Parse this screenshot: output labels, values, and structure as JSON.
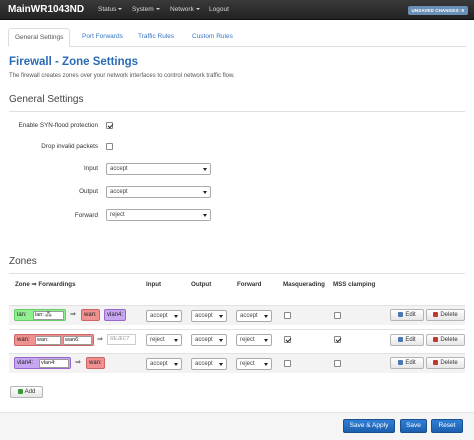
{
  "nav": {
    "brand": "MainWR1043ND",
    "items": [
      "Status",
      "System",
      "Network",
      "Logout"
    ],
    "unsaved": "UNSAVED CHANGES: 9"
  },
  "tabs": [
    "General Settings",
    "Port Forwards",
    "Traffic Rules",
    "Custom Rules"
  ],
  "page": {
    "title": "Firewall - Zone Settings",
    "description": "The firewall creates zones over your network interfaces to control network traffic flow."
  },
  "general": {
    "title": "General Settings",
    "syn_flood_label": "Enable SYN-flood protection",
    "syn_flood_checked": true,
    "drop_invalid_label": "Drop invalid packets",
    "drop_invalid_checked": false,
    "input_label": "Input",
    "input_value": "accept",
    "output_label": "Output",
    "output_value": "accept",
    "forward_label": "Forward",
    "forward_value": "reject"
  },
  "zones": {
    "title": "Zones",
    "headers": [
      "Zone ⇒ Forwardings",
      "Input",
      "Output",
      "Forward",
      "Masquerading",
      "MSS clamping"
    ],
    "rows": [
      {
        "zone": "lan:",
        "networks": [
          "lan:",
          "🖧"
        ],
        "forward_to": [
          "wan:",
          "vlan4:"
        ],
        "input": "accept",
        "output": "accept",
        "forward": "accept",
        "masquerading": false,
        "mss": false,
        "color": "#90f090"
      },
      {
        "zone": "wan:",
        "networks": [
          "wan:",
          "wan6:"
        ],
        "forward_to": [
          "REJECT"
        ],
        "input": "reject",
        "output": "accept",
        "forward": "reject",
        "masquerading": true,
        "mss": true,
        "color": "#f09090"
      },
      {
        "zone": "vlan4:",
        "networks": [
          "vlan4:"
        ],
        "forward_to": [
          "wan:"
        ],
        "input": "accept",
        "output": "accept",
        "forward": "reject",
        "masquerading": false,
        "mss": false,
        "color": "#c7a7f2"
      }
    ],
    "edit_label": "Edit",
    "delete_label": "Delete",
    "add_label": "Add"
  },
  "footer": {
    "save_apply": "Save & Apply",
    "save": "Save",
    "reset": "Reset"
  },
  "colors": {
    "accent": "#2a6bb5",
    "lan_zone": "#90f090",
    "wan_zone": "#f09090",
    "vlan_zone": "#c7a7f2"
  }
}
